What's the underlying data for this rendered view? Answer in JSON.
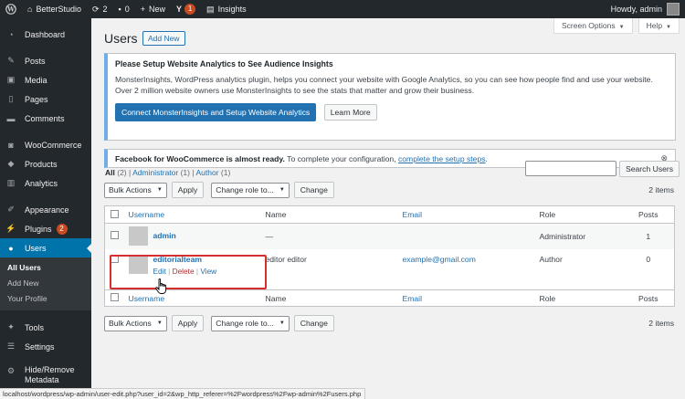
{
  "adminbar": {
    "site_name": "BetterStudio",
    "updates": "2",
    "comments": "0",
    "new_label": "New",
    "yoast_badge": "1",
    "insights_label": "Insights",
    "howdy": "Howdy, admin"
  },
  "sidebar": {
    "items": [
      {
        "label": "Dashboard",
        "icon": "dashboard-icon"
      },
      {
        "label": "Posts",
        "icon": "pin-icon"
      },
      {
        "label": "Media",
        "icon": "media-icon"
      },
      {
        "label": "Pages",
        "icon": "page-icon"
      },
      {
        "label": "Comments",
        "icon": "comment-icon"
      },
      {
        "label": "WooCommerce",
        "icon": "woocommerce-icon"
      },
      {
        "label": "Products",
        "icon": "box-icon"
      },
      {
        "label": "Analytics",
        "icon": "chart-icon"
      },
      {
        "label": "Appearance",
        "icon": "brush-icon"
      },
      {
        "label": "Plugins",
        "icon": "plug-icon",
        "badge": "2"
      },
      {
        "label": "Users",
        "icon": "user-icon"
      },
      {
        "label": "Tools",
        "icon": "wrench-icon"
      },
      {
        "label": "Settings",
        "icon": "settings-icon"
      },
      {
        "label": "Hide/Remove Metadata",
        "icon": "gear-icon"
      }
    ],
    "submenu": [
      "All Users",
      "Add New",
      "Your Profile"
    ]
  },
  "header": {
    "screen_options": "Screen Options",
    "help": "Help",
    "title": "Users",
    "add_new": "Add New"
  },
  "mi_notice": {
    "heading": "Please Setup Website Analytics to See Audience Insights",
    "body": "MonsterInsights, WordPress analytics plugin, helps you connect your website with Google Analytics, so you can see how people find and use your website. Over 2 million website owners use MonsterInsights to see the stats that matter and grow their business.",
    "connect_button": "Connect MonsterInsights and Setup Website Analytics",
    "learn_more": "Learn More"
  },
  "fb_notice": {
    "bold": "Facebook for WooCommerce is almost ready.",
    "text": " To complete your configuration, ",
    "link": "complete the setup steps",
    "after": "."
  },
  "filters": {
    "all": "All",
    "all_count": "(2)",
    "admin": "Administrator",
    "admin_count": "(1)",
    "author": "Author",
    "author_count": "(1)",
    "sep": "|"
  },
  "search": {
    "button": "Search Users",
    "value": ""
  },
  "actions": {
    "bulk": "Bulk Actions",
    "apply": "Apply",
    "change_role": "Change role to...",
    "change": "Change",
    "items": "2 items"
  },
  "table": {
    "columns": [
      "Username",
      "Name",
      "Email",
      "Role",
      "Posts"
    ],
    "rows": [
      {
        "username": "admin",
        "name": "—",
        "email": "",
        "role": "Administrator",
        "posts": "1"
      },
      {
        "username": "editorialteam",
        "name": "editor editor",
        "email": "example@gmail.com",
        "role": "Author",
        "posts": "0",
        "actions": {
          "edit": "Edit",
          "delete": "Delete",
          "view": "View",
          "sep": "|"
        }
      }
    ]
  },
  "statusbar": "localhost/wordpress/wp-admin/user-edit.php?user_id=2&wp_http_referer=%2Fwordpress%2Fwp-admin%2Fusers.php",
  "colors": {
    "accent": "#0073aa",
    "highlight": "#d92e2e",
    "badge": "#ca4a1f"
  }
}
